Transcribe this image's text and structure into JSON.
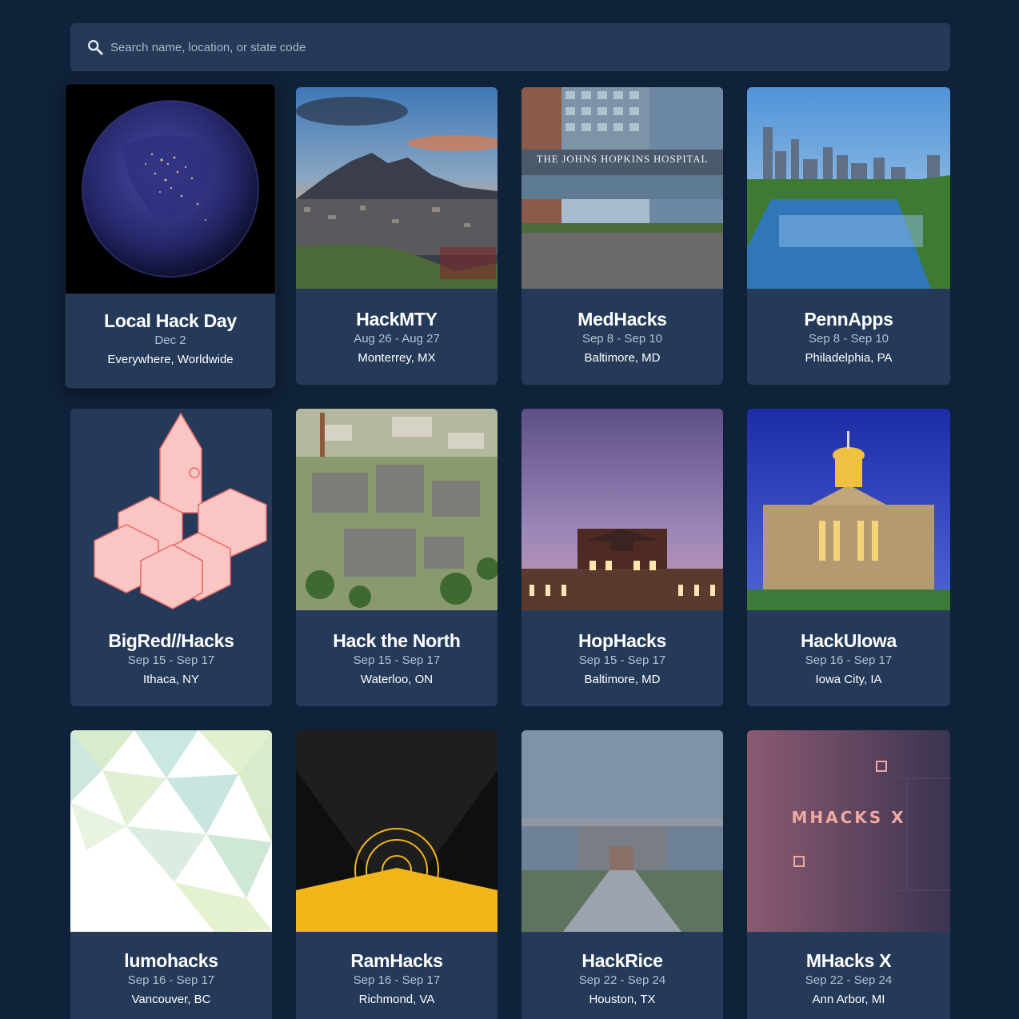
{
  "search": {
    "placeholder": "Search name, location, or state code"
  },
  "events": [
    {
      "name": "Local Hack Day",
      "date": "Dec 2",
      "location": "Everywhere, Worldwide",
      "image_icon": "earth-at-night"
    },
    {
      "name": "HackMTY",
      "date": "Aug 26 - Aug 27",
      "location": "Monterrey, MX",
      "image_icon": "mountain-city-sunset"
    },
    {
      "name": "MedHacks",
      "date": "Sep 8 - Sep 10",
      "location": "Baltimore, MD",
      "image_icon": "hospital-building",
      "image_text": "THE JOHNS HOPKINS HOSPITAL"
    },
    {
      "name": "PennApps",
      "date": "Sep 8 - Sep 10",
      "location": "Philadelphia, PA",
      "image_icon": "city-skyline-river"
    },
    {
      "name": "BigRed//Hacks",
      "date": "Sep 15 - Sep 17",
      "location": "Ithaca, NY",
      "image_icon": "isometric-clocktower-logo"
    },
    {
      "name": "Hack the North",
      "date": "Sep 15 - Sep 17",
      "location": "Waterloo, ON",
      "image_icon": "aerial-campus"
    },
    {
      "name": "HopHacks",
      "date": "Sep 15 - Sep 17",
      "location": "Baltimore, MD",
      "image_icon": "brick-hall-dusk"
    },
    {
      "name": "HackUIowa",
      "date": "Sep 16 - Sep 17",
      "location": "Iowa City, IA",
      "image_icon": "capitol-building-night"
    },
    {
      "name": "lumohacks",
      "date": "Sep 16 - Sep 17",
      "location": "Vancouver, BC",
      "image_icon": "low-poly-pattern"
    },
    {
      "name": "RamHacks",
      "date": "Sep 16 - Sep 17",
      "location": "Richmond, VA",
      "image_icon": "gear-sunrise-logo"
    },
    {
      "name": "HackRice",
      "date": "Sep 22 - Sep 24",
      "location": "Houston, TX",
      "image_icon": "pavilion-walkway"
    },
    {
      "name": "MHacks X",
      "date": "Sep 22 - Sep 24",
      "location": "Ann Arbor, MI",
      "image_icon": "mhacks-logo",
      "image_text": "MHACKS X"
    }
  ],
  "colors": {
    "background": "#10213a",
    "card": "#243a58",
    "search_bg": "#243a58",
    "date_text": "#b5c0cf"
  }
}
